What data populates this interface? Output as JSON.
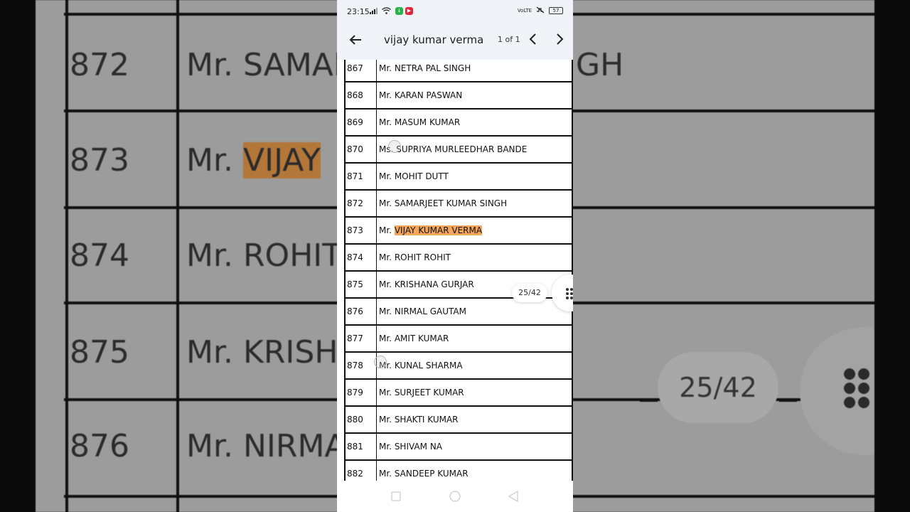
{
  "status_bar": {
    "time": "23:15",
    "network": "VoLTE",
    "battery": "57"
  },
  "search": {
    "query": "vijay kumar verma",
    "match_count": "1 of 1"
  },
  "table": {
    "rows": [
      {
        "num": "867",
        "name": "Mr. NETRA PAL SINGH"
      },
      {
        "num": "868",
        "name": "Mr. KARAN PASWAN"
      },
      {
        "num": "869",
        "name": "Mr. MASUM KUMAR"
      },
      {
        "num": "870",
        "name": "Ms. SUPRIYA MURLEEDHAR BANDE"
      },
      {
        "num": "871",
        "name": "Mr. MOHIT DUTT"
      },
      {
        "num": "872",
        "name": "Mr. SAMARJEET KUMAR SINGH"
      },
      {
        "num": "873",
        "prefix": "Mr. ",
        "highlight": "VIJAY KUMAR VERMA"
      },
      {
        "num": "874",
        "name": "Mr. ROHIT ROHIT"
      },
      {
        "num": "875",
        "name": "Mr. KRISHANA GURJAR"
      },
      {
        "num": "876",
        "name": "Mr. NIRMAL GAUTAM"
      },
      {
        "num": "877",
        "name": "Mr. AMIT KUMAR"
      },
      {
        "num": "878",
        "name": "Mr. KUNAL SHARMA"
      },
      {
        "num": "879",
        "name": "Mr. SURJEET KUMAR"
      },
      {
        "num": "880",
        "name": "Mr. SHAKTI KUMAR"
      },
      {
        "num": "881",
        "name": "Mr. SHIVAM NA"
      },
      {
        "num": "882",
        "name": "Mr. SANDEEP KUMAR"
      }
    ]
  },
  "page_indicator": "25/42",
  "background": {
    "rows": [
      {
        "num": "872",
        "name": "Mr. SAMAR",
        "tail": "GH"
      },
      {
        "num": "873",
        "prefix": "Mr. ",
        "highlight": "VIJAY"
      },
      {
        "num": "874",
        "name": "Mr. ROHIT"
      },
      {
        "num": "875",
        "name": "Mr. KRISH"
      },
      {
        "num": "876",
        "name": "Mr. NIRMA"
      }
    ],
    "page_indicator": "25/42"
  },
  "colors": {
    "highlight": "#f4a65a",
    "toolbar_bg": "#f0f3f8"
  }
}
